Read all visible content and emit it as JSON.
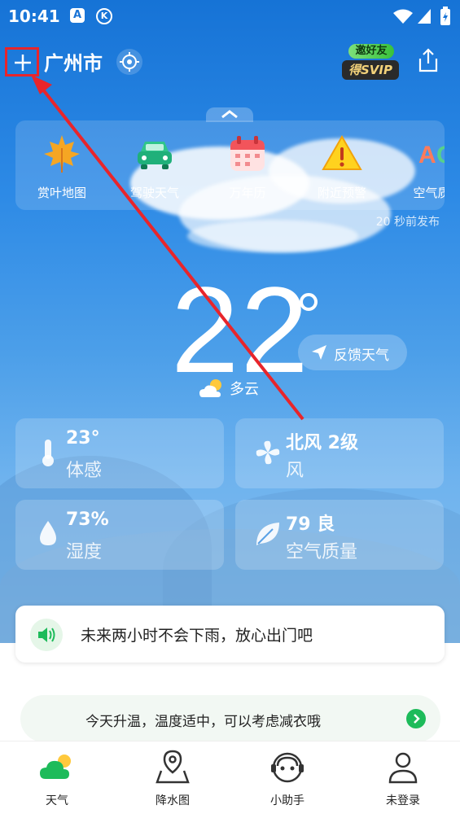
{
  "status_bar": {
    "time": "10:41",
    "icon_a": "A",
    "icon_k": "K"
  },
  "header": {
    "city": "广州市",
    "invite_top": "邀好友",
    "invite_bottom": "得SVIP"
  },
  "quick_panel": {
    "items": [
      {
        "label": "赏叶地图",
        "icon": "maple-leaf-icon"
      },
      {
        "label": "驾驶天气",
        "icon": "car-icon"
      },
      {
        "label": "万年历",
        "icon": "calendar-icon"
      },
      {
        "label": "附近预警",
        "icon": "warning-icon"
      },
      {
        "label": "空气质",
        "icon": "aqi-icon"
      }
    ],
    "publish_time": "20 秒前发布"
  },
  "current": {
    "temperature": "22",
    "condition": "多云",
    "feedback_label": "反馈天气"
  },
  "details": [
    {
      "value": "23°",
      "label": "体感",
      "icon": "thermometer-icon"
    },
    {
      "value": "北风 2级",
      "label": "风",
      "icon": "fan-icon"
    },
    {
      "value": "73%",
      "label": "湿度",
      "icon": "drop-icon"
    },
    {
      "value": "79 良",
      "label": "空气质量",
      "icon": "leaf-icon"
    }
  ],
  "rain_notice": "未来两小时不会下雨，放心出门吧",
  "tip": "今天升温，温度适中，可以考虑减衣哦",
  "tabs": [
    {
      "label": "天气",
      "icon": "weather-cloud-icon"
    },
    {
      "label": "降水图",
      "icon": "map-pin-icon"
    },
    {
      "label": "小助手",
      "icon": "assistant-icon"
    },
    {
      "label": "未登录",
      "icon": "user-icon"
    }
  ],
  "colors": {
    "accent_green": "#1dbb5a",
    "annotation_red": "#e8252b",
    "sky_top": "#1673d6"
  }
}
